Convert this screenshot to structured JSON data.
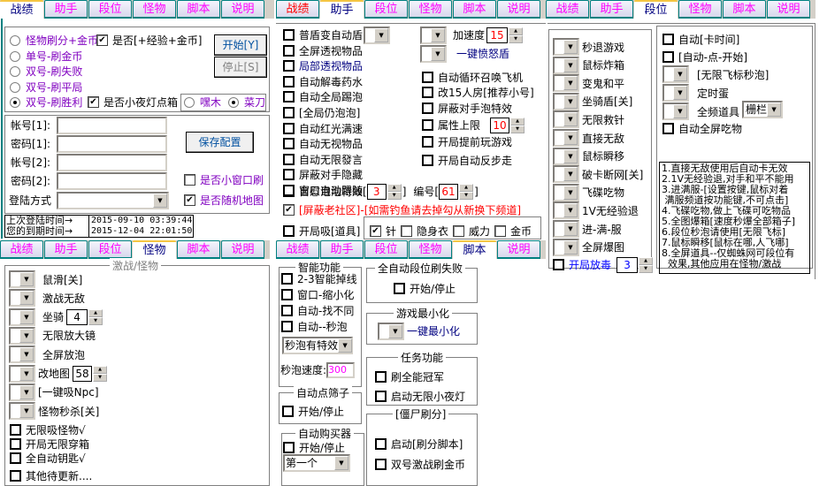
{
  "tabs": [
    "战绩",
    "助手",
    "段位",
    "怪物",
    "脚本",
    "说明"
  ],
  "panel_stats": {
    "modes": [
      {
        "label": "怪物刷分+金币",
        "selected": false
      },
      {
        "label": "单号-刷金币",
        "selected": false
      },
      {
        "label": "双号-刷失败",
        "selected": false
      },
      {
        "label": "双号-刷平局",
        "selected": false
      },
      {
        "label": "双号-刷胜利",
        "selected": true
      }
    ],
    "exp_gold_checkbox": {
      "label": "是否[+经验+金币]",
      "checked": true
    },
    "nightlight_checkbox": {
      "label": "是否小夜灯点箱",
      "checked": true
    },
    "char_options": [
      {
        "label": "嘿木",
        "selected": false
      },
      {
        "label": "菜刀",
        "selected": true
      }
    ],
    "start_button": "开始[Y]",
    "stop_button": "停止[S]",
    "account1_label": "帐号[1]:",
    "password1_label": "密码[1]:",
    "account2_label": "帐号[2]:",
    "password2_label": "密码[2]:",
    "login_method_label": "登陆方式",
    "save_button": "保存配置",
    "small_window_checkbox": {
      "label": "是否小窗口刷",
      "checked": false
    },
    "random_map_checkbox": {
      "label": "是否随机地图",
      "checked": true
    },
    "last_login_label": "上次登陆时间→",
    "last_login_value": "2015-09-10 03:39:44",
    "expire_label": "您的到期时间→",
    "expire_value": "2015-12-04 22:01:50"
  },
  "panel_helper": {
    "left_items": [
      {
        "label": "普盾变自动盾",
        "dropdown": true
      },
      {
        "label": "全屏透视物品"
      },
      {
        "label": "局部透视物品",
        "color": "blue"
      },
      {
        "label": "自动解毒药水"
      },
      {
        "label": "自动全局踢泡"
      },
      {
        "label": "[全局仍泡泡]"
      },
      {
        "label": "自动红光满速"
      },
      {
        "label": "自动无视物品"
      },
      {
        "label": "自动无限發言"
      },
      {
        "label": "屏蔽对手隐藏"
      },
      {
        "label": "窗口自动跟随"
      }
    ],
    "bubble_effect_label": "自慰泡泡特效[",
    "bubble_effect_value": "3",
    "number_label": "编号[",
    "number_value": "61",
    "community_checkbox": {
      "label": "[屏蔽老社区]-[如需钓鱼请去掉勾从新换下频道]",
      "checked": true
    },
    "speed_label": "加速度",
    "speed_value": "15",
    "shield_label": "一键愤怒盾",
    "right_items": [
      {
        "label": "自动循环召唤飞机"
      },
      {
        "label": "改15人房[推荐小号]"
      },
      {
        "label": "屏蔽对手泡特效"
      },
      {
        "label": "属性上限"
      },
      {
        "label": "开局提前玩游戏"
      },
      {
        "label": "开局自动反步走"
      }
    ],
    "attr_limit_value": "10",
    "absorb_label": "开局吸[道具]",
    "absorb_items": [
      {
        "label": "针",
        "checked": true
      },
      {
        "label": "隐身衣",
        "checked": false
      },
      {
        "label": "威力",
        "checked": false
      },
      {
        "label": "金币",
        "checked": false
      }
    ]
  },
  "panel_rank": {
    "left_items": [
      "秒退游戏",
      "鼠标炸箱",
      "变鬼和平",
      "坐骑盾[关]",
      "无限救针",
      "直接无敌",
      "鼠标瞬移",
      "破卡断网[关]",
      "飞碟吃物",
      "1V无经验退",
      "进-满-服",
      "全屏爆图"
    ],
    "poison_label": "开局放毒",
    "poison_value": "3",
    "right_checks": [
      "自动[卡时间]",
      "[自动-点-开始]"
    ],
    "right_dropdowns": [
      "[无限飞标秒泡]",
      "定时蛋",
      "全频道具"
    ],
    "fence_value": "栅栏",
    "auto_eat_label": "自动全屏吃物",
    "notes": "1.直接无敌使用后自动卡无效\n2.1V无经验退,对手和平不能用\n3.进满服-[设置按键,鼠标对着\n 满服频道按功能键,不可点击]\n4.飞碟吃物,做上飞碟可吃物品\n5.全图爆箱[速度秒爆全部箱子]\n6.段位秒泡请使用[无限飞标]\n7.鼠标瞬移[鼠标在哪,人飞哪]\n8.全屏道具--仅蜘蛛网可段位有\n  效果,其他应用在怪物/激战"
  },
  "panel_monster": {
    "legend": "激战/怪物",
    "dropdown_items": [
      "鼠滑[关]",
      "激战无敌",
      "坐骑",
      "无限放大镜",
      "全屏放泡",
      "改地图",
      "[一键吸Npc]",
      "怪物秒杀[关]"
    ],
    "mount_value": "4",
    "map_value": "58",
    "check_items": [
      "无限吸怪物√",
      "开局无限穿箱",
      "全自动钥匙√",
      "其他待更新...."
    ]
  },
  "panel_script": {
    "smart_legend": "智能功能",
    "smart_items": [
      "2-3智能掉线",
      "窗口-缩小化",
      "自动-找不同",
      "自动--秒泡"
    ],
    "bubble_select": "秒泡有特效",
    "bubble_speed_label": "秒泡速度:",
    "bubble_speed_value": "300",
    "dice_legend": "自动点筛子",
    "dice_item": "开始/停止",
    "buyer_legend": "自动购买器",
    "buyer_item": "开始/停止",
    "buyer_select": "第一个",
    "rankfail_legend": "全自动段位刷失败",
    "rankfail_item": "开始/停止",
    "minimize_legend": "游戏最小化",
    "minimize_label": "一键最小化",
    "task_legend": "任务功能",
    "task_items": [
      "刷全能冠军",
      "启动无限小夜灯"
    ],
    "zombie_legend": "[僵尸刷分]",
    "zombie_items": [
      "启动[刷分脚本]",
      "双号激战刷金币"
    ]
  }
}
